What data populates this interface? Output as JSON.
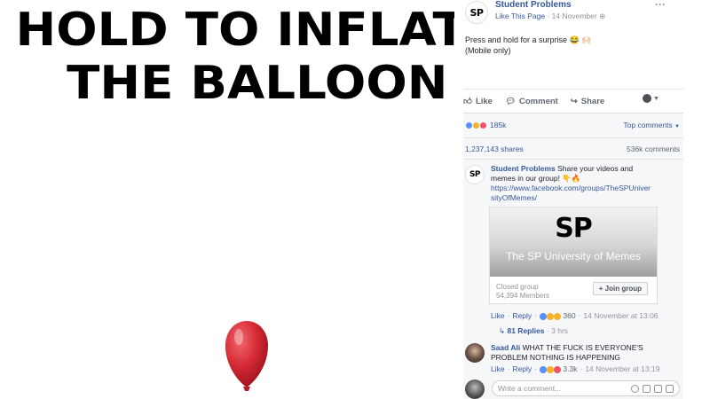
{
  "video": {
    "headline_line1": "HOLD TO INFLATE",
    "headline_line2": "THE BALLOON",
    "balloon_color": "#d62b36"
  },
  "post": {
    "page_name": "Student Problems",
    "avatar_text": "SP",
    "like_page": "Like This Page",
    "date": "14 November",
    "text_line1": "Press and hold for a surprise 😂 🙌🏻",
    "text_line2": "(Mobile only)"
  },
  "actions": {
    "like": "Like",
    "comment": "Comment",
    "share": "Share"
  },
  "stats": {
    "reactions_count": "185k",
    "top_comments": "Top comments",
    "shares": "1,237,143 shares",
    "comments": "536k comments"
  },
  "comment1": {
    "author": "Student Problems",
    "text": "Share your videos and memes in our group! 👇🔥",
    "link_line1": "https://www.facebook.com/groups/TheSPUniver",
    "link_line2": "sityOfMemes/",
    "card_logo": "SP",
    "card_title": "The SP University of Memes",
    "group_type": "Closed group",
    "members": "54,394 Members",
    "join_label": "+ Join group",
    "like": "Like",
    "reply": "Reply",
    "reactions": "360",
    "time": "14 November at 13:06",
    "replies": "81 Replies",
    "replies_time": "3 hrs"
  },
  "comment2": {
    "author": "Saad Ali",
    "text_line1": "WHAT THE FUCK IS EVERYONE'S",
    "text_line2": "PROBLEM NOTHING IS HAPPENING",
    "like": "Like",
    "reply": "Reply",
    "reactions": "3.3k",
    "time": "14 November at 13:19"
  },
  "composer": {
    "placeholder": "Write a comment..."
  },
  "colors": {
    "link": "#365899",
    "like_blue": "#5890ff",
    "love_red": "#f25268",
    "haha_yellow": "#f7b125"
  }
}
